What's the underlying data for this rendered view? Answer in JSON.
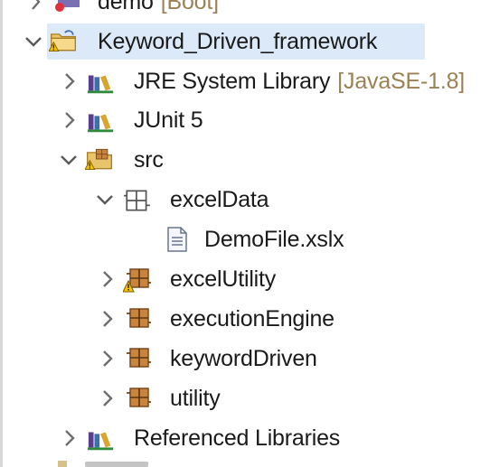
{
  "tree": {
    "top_partial": {
      "label": "demo",
      "decoration": "[Boot]"
    },
    "project": {
      "label": "Keyword_Driven_framework",
      "expanded": true,
      "selected": true,
      "icon": "project-folder-warning-icon"
    },
    "jre": {
      "label": "JRE System Library",
      "decoration": "[JavaSE-1.8]",
      "icon": "library-icon"
    },
    "junit": {
      "label": "JUnit 5",
      "icon": "library-icon"
    },
    "src": {
      "label": "src",
      "expanded": true,
      "icon": "source-folder-warning-icon"
    },
    "exceldata": {
      "label": "excelData",
      "expanded": true,
      "icon": "empty-package-icon"
    },
    "demofile": {
      "label": "DemoFile.xslx",
      "icon": "file-icon"
    },
    "excelutility": {
      "label": "excelUtility",
      "icon": "package-warning-icon"
    },
    "executionengine": {
      "label": "executionEngine",
      "icon": "package-icon"
    },
    "keyworddriven": {
      "label": "keywordDriven",
      "icon": "package-icon"
    },
    "utility": {
      "label": "utility",
      "icon": "package-icon"
    },
    "reflibs": {
      "label": "Referenced Libraries",
      "icon": "library-icon"
    }
  },
  "colors": {
    "selection": "#dbe9f8",
    "decoration": "#9b8255",
    "package": "#b8733a",
    "warning": "#f5c400"
  }
}
